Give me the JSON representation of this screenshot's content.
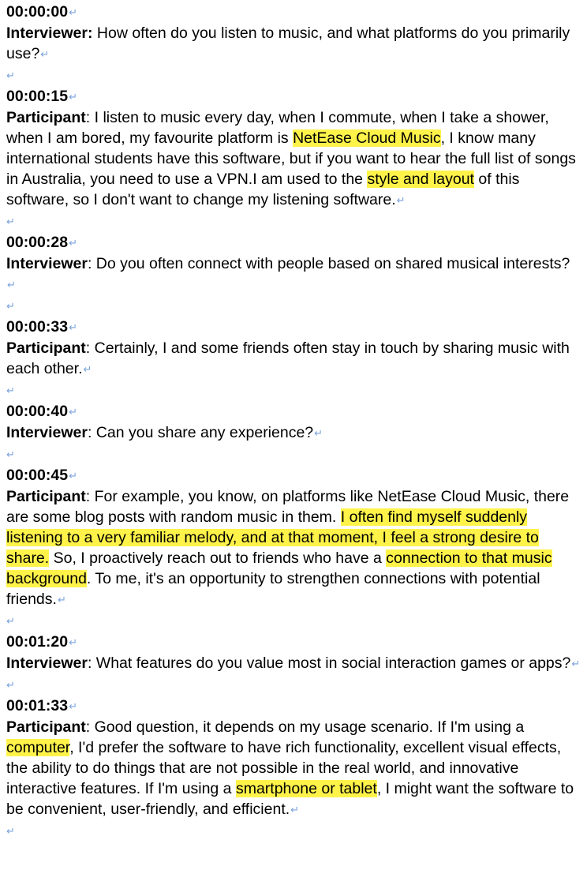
{
  "paragraph_mark": "↵",
  "entries": [
    {
      "timestamp": "00:00:00",
      "speaker": "Interviewer:",
      "segments": [
        {
          "text": " How often do you listen to music, and what platforms do you primarily use?",
          "highlight": false
        }
      ]
    },
    {
      "timestamp": "00:00:15",
      "speaker": "Participant",
      "segments": [
        {
          "text": ": I listen to music every day, when I commute, when I take a shower, when I am bored, my favourite platform is ",
          "highlight": false
        },
        {
          "text": "NetEase Cloud Music",
          "highlight": true
        },
        {
          "text": ", I know many international students have this software, but if you want to hear the full list of songs in Australia, you need to use a VPN.I am used to the ",
          "highlight": false
        },
        {
          "text": "style and layout",
          "highlight": true
        },
        {
          "text": " of this software, so I don't want to change my listening software.",
          "highlight": false
        }
      ]
    },
    {
      "timestamp": "00:00:28",
      "speaker": "Interviewer",
      "segments": [
        {
          "text": ": Do you often connect with people based on shared musical interests? ",
          "highlight": false
        }
      ]
    },
    {
      "timestamp": "00:00:33",
      "speaker": "Participant",
      "segments": [
        {
          "text": ": Certainly, I and some friends often stay in touch by sharing music with each other.",
          "highlight": false
        }
      ]
    },
    {
      "timestamp": "00:00:40",
      "speaker": "Interviewer",
      "segments": [
        {
          "text": ": Can you share any experience?",
          "highlight": false
        }
      ]
    },
    {
      "timestamp": "00:00:45",
      "speaker": "Participant",
      "segments": [
        {
          "text": ": For example, you know, on platforms like NetEase Cloud Music, there are some blog posts with random music in them. ",
          "highlight": false
        },
        {
          "text": "I often find myself suddenly listening to a very familiar melody, and at that moment, I feel a strong desire to share.",
          "highlight": true
        },
        {
          "text": " So, I proactively reach out to friends who have a ",
          "highlight": false
        },
        {
          "text": "connection to that music background",
          "highlight": true
        },
        {
          "text": ". To me, it's an opportunity to strengthen connections with potential friends.",
          "highlight": false
        }
      ]
    },
    {
      "timestamp": "00:01:20",
      "speaker": "Interviewer",
      "segments": [
        {
          "text": ": What features do you value most in social interaction games or apps?",
          "highlight": false
        }
      ]
    },
    {
      "timestamp": "00:01:33",
      "speaker": "Participant",
      "segments": [
        {
          "text": ": Good question, it depends on my usage scenario. If I'm using a ",
          "highlight": false
        },
        {
          "text": "computer",
          "highlight": true
        },
        {
          "text": ", I'd prefer the software to have rich functionality, excellent visual effects, the ability to do things that are not possible in the real world, and innovative interactive features. If I'm using a ",
          "highlight": false
        },
        {
          "text": "smartphone or tablet",
          "highlight": true
        },
        {
          "text": ", I might want the software to be convenient, user-friendly, and efficient.",
          "highlight": false
        }
      ]
    }
  ]
}
